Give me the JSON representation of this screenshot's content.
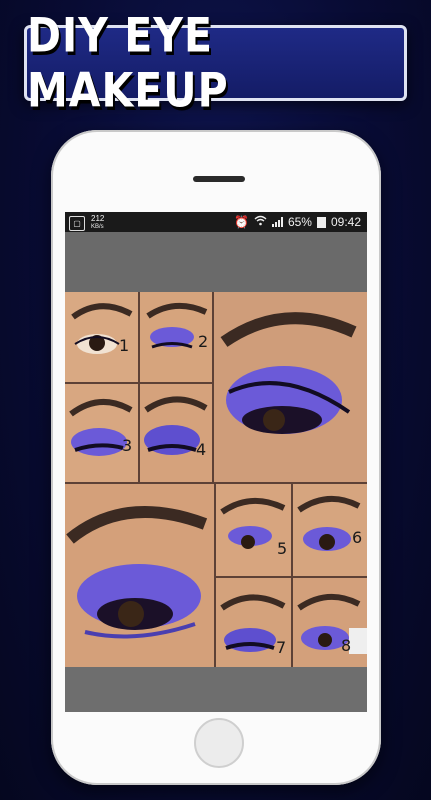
{
  "banner": {
    "title": "DIY EYE MAKEUP"
  },
  "status_bar": {
    "data_speed": "212",
    "data_unit": "KB/s",
    "battery_percent": "65%",
    "time": "09:42",
    "icons": [
      "alarm-icon",
      "wifi-icon",
      "signal-icon",
      "battery-icon"
    ]
  },
  "collage": {
    "step_numbers": [
      "1",
      "2",
      "3",
      "4",
      "5",
      "6",
      "7",
      "8"
    ],
    "colors": {
      "skin": "#d7a37f",
      "shadow": "#6b5ad8",
      "liner": "#120c22",
      "brow": "#3b2a22"
    }
  },
  "colors": {
    "background": "#080b33",
    "banner": "#1b2578",
    "phone": "#fbfbfb",
    "screen": "#6e6e6e"
  }
}
